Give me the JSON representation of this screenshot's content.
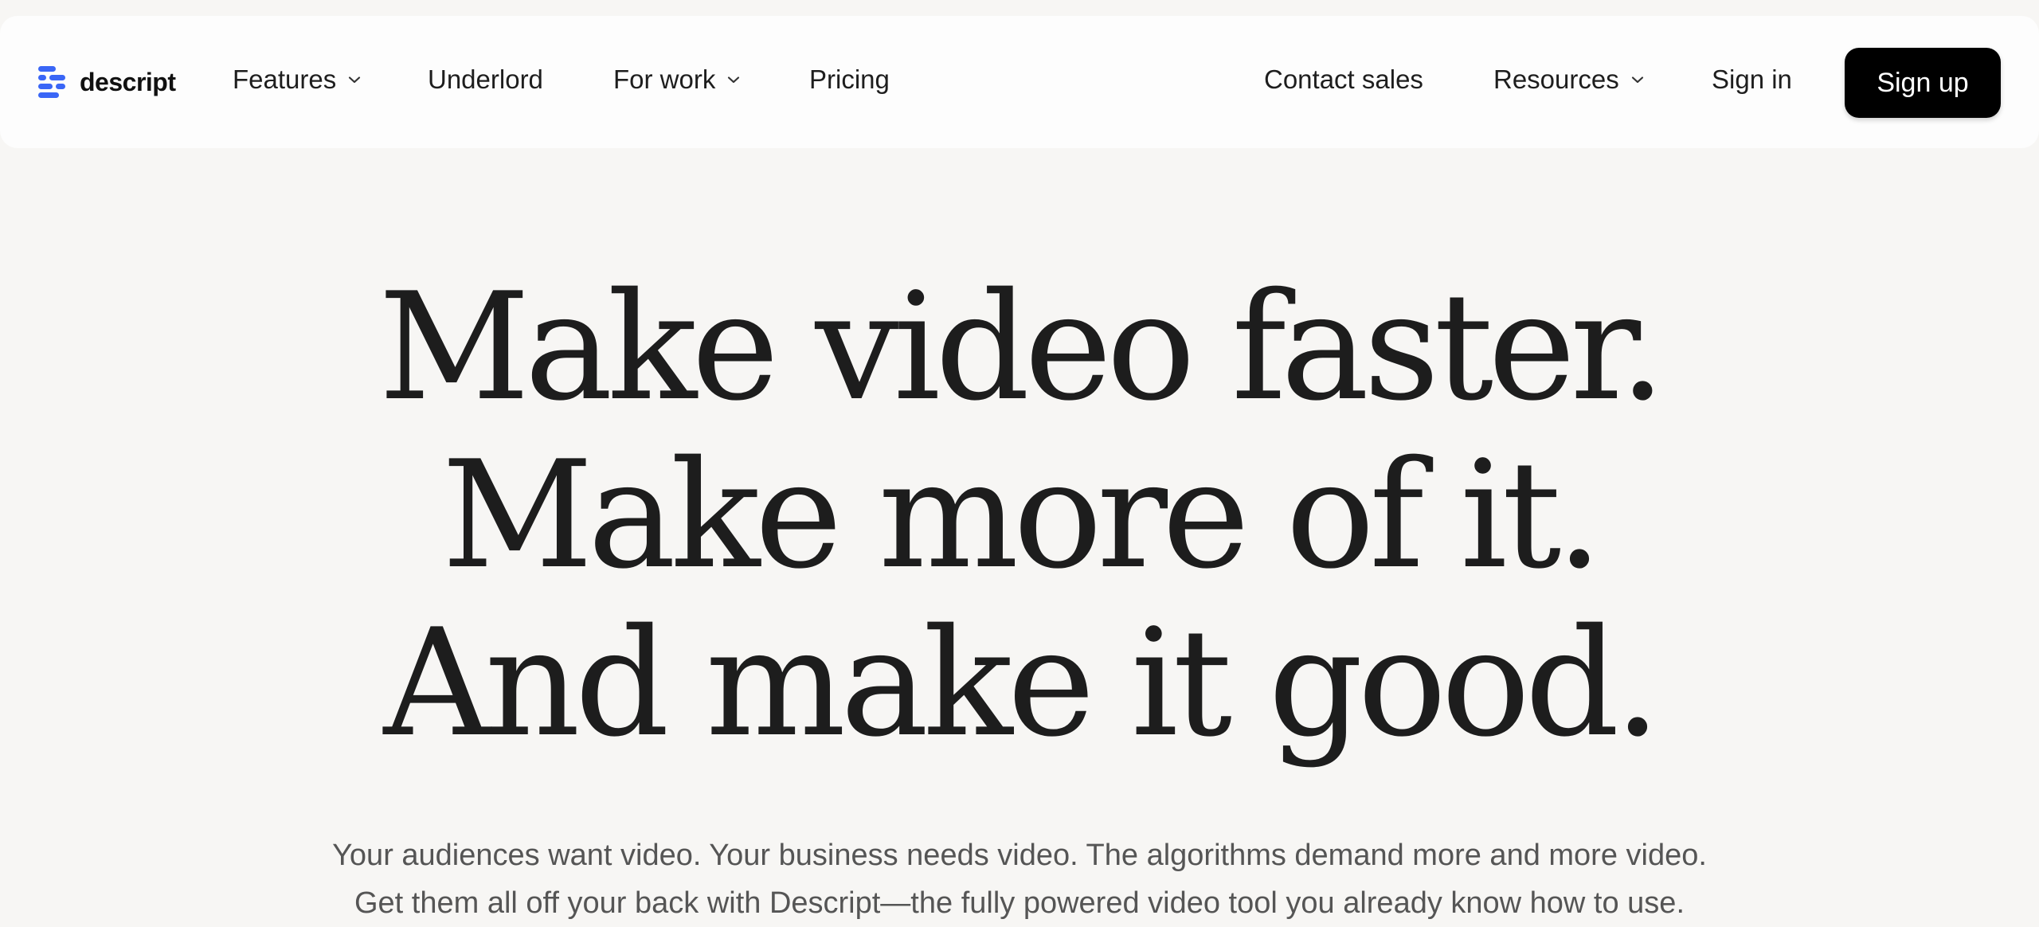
{
  "brand": {
    "name": "descript",
    "accent_color": "#3a66f6",
    "logo_icon": "descript-logo-icon"
  },
  "nav": {
    "left_items": [
      {
        "label": "Features",
        "has_dropdown": true
      },
      {
        "label": "Underlord",
        "has_dropdown": false
      },
      {
        "label": "For work",
        "has_dropdown": true
      },
      {
        "label": "Pricing",
        "has_dropdown": false
      }
    ],
    "right_items": [
      {
        "label": "Contact sales",
        "has_dropdown": false
      },
      {
        "label": "Resources",
        "has_dropdown": true
      },
      {
        "label": "Sign in",
        "has_dropdown": false
      }
    ],
    "cta": {
      "label": "Sign up",
      "color": "#000000"
    }
  },
  "hero": {
    "headline_lines": [
      "Make video faster.",
      "Make more of it.",
      "And make it good."
    ],
    "subtitle_lines": [
      "Your audiences want video. Your business needs video. The algorithms demand more and more video.",
      "Get them all off your back with Descript—the fully powered video tool you already know how to use."
    ]
  }
}
